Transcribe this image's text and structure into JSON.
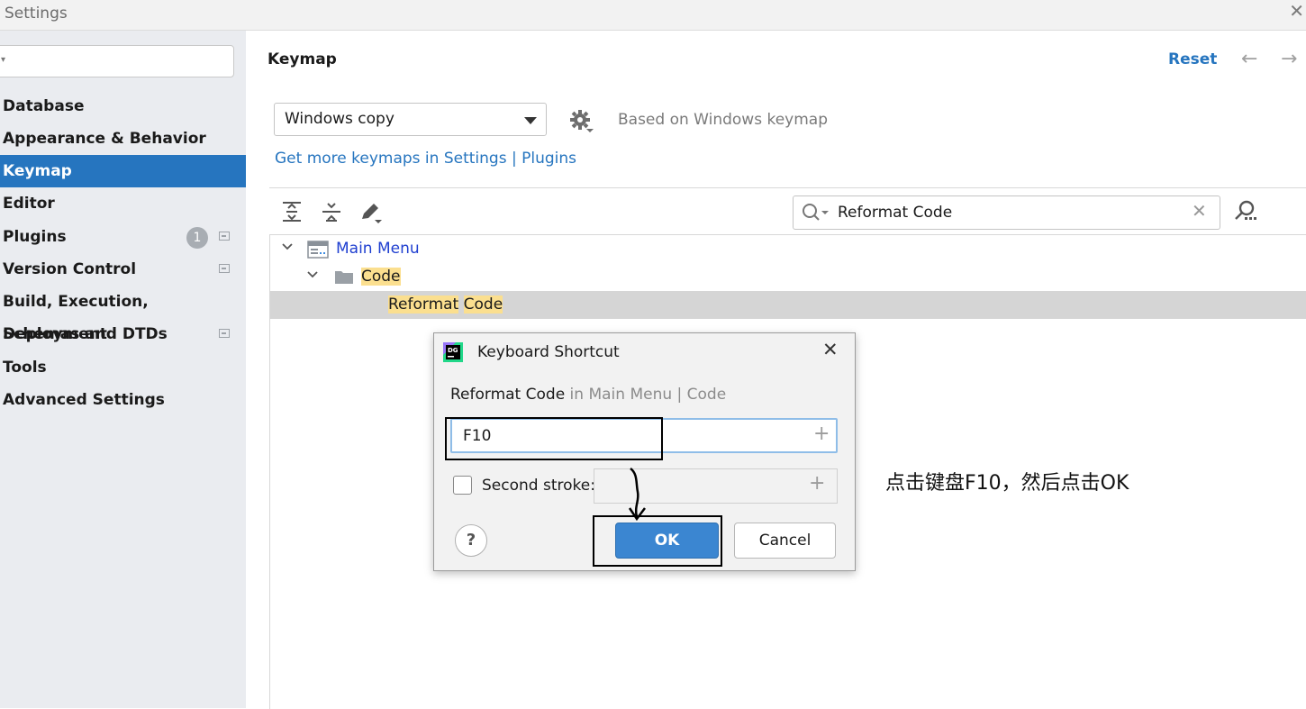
{
  "window": {
    "title": "Settings",
    "close_glyph": "✕"
  },
  "sidebar": {
    "search": {
      "value": ""
    },
    "items": [
      {
        "label": "Database"
      },
      {
        "label": "Appearance & Behavior"
      },
      {
        "label": "Keymap",
        "selected": true
      },
      {
        "label": "Editor"
      },
      {
        "label": "Plugins",
        "badge": "1",
        "project_icon": "project-level-icon"
      },
      {
        "label": "Version Control",
        "project_icon": "project-level-icon"
      },
      {
        "label": "Build, Execution, Deployment"
      },
      {
        "label": "Schemas and DTDs",
        "project_icon": "project-level-icon"
      },
      {
        "label": "Tools"
      },
      {
        "label": "Advanced Settings"
      }
    ]
  },
  "header": {
    "title": "Keymap",
    "reset": "Reset",
    "back_glyph": "←",
    "forward_glyph": "→"
  },
  "keymap": {
    "selected": "Windows copy",
    "based_on": "Based on Windows keymap",
    "more_link": "Get more keymaps in Settings | Plugins"
  },
  "toolbar": {
    "icons": [
      "expand-all-icon",
      "collapse-all-icon",
      "edit-icon"
    ],
    "filter_value": "Reformat Code",
    "clear_glyph": "✕",
    "find_by_shortcut_icon": "find-by-shortcut-icon"
  },
  "tree": {
    "root": {
      "label": "Main Menu",
      "chevron": "⌄"
    },
    "group": {
      "label": "Code",
      "chevron": "⌄"
    },
    "action": {
      "word1": "Reformat",
      "space": " ",
      "word2": "Code"
    }
  },
  "dialog": {
    "title": "Keyboard Shortcut",
    "close_glyph": "✕",
    "action_name": "Reformat Code",
    "action_path": " in Main Menu | Code",
    "first_stroke": "F10",
    "plus_glyph": "+",
    "second_stroke_label": "Second stroke:",
    "second_stroke_checked": false,
    "help_glyph": "?",
    "ok": "OK",
    "cancel": "Cancel"
  },
  "annotation": {
    "text": "点击键盘F10，然后点击OK"
  },
  "colors": {
    "accent": "#2675bf",
    "sidebar_bg": "#eaecf0",
    "highlight": "#fbdf8f",
    "selected_row": "#d5d5d5",
    "ok_button": "#3b86d1"
  }
}
